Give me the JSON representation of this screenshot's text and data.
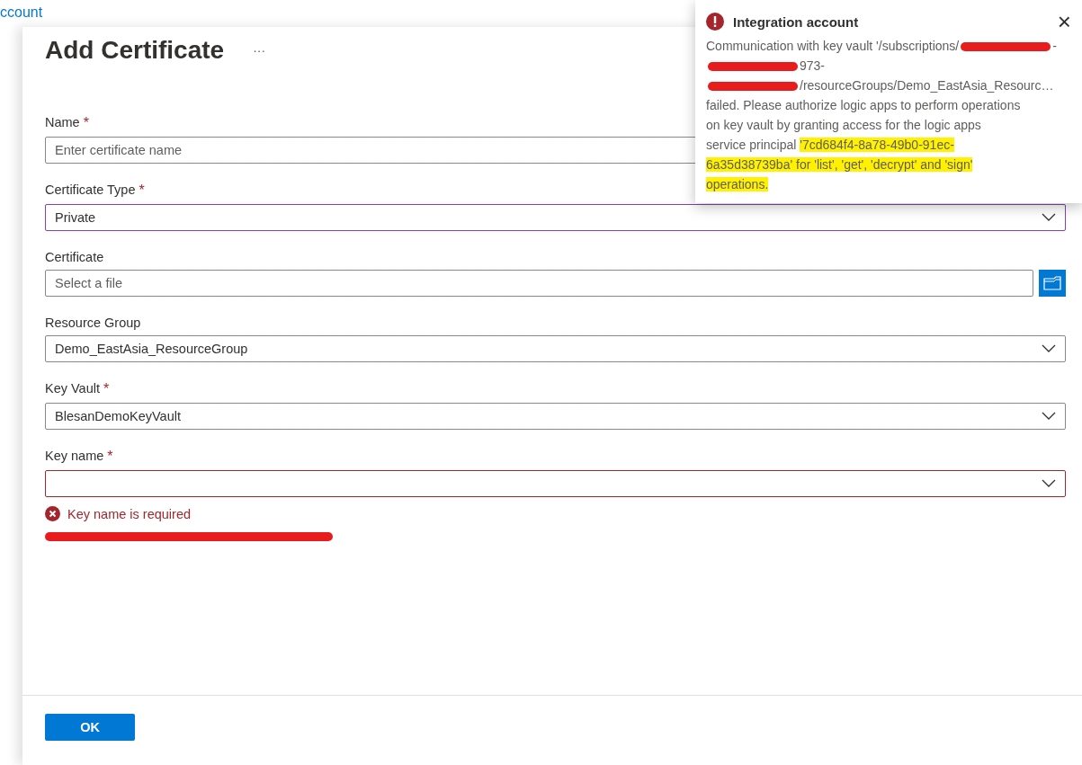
{
  "breadcrumb": {
    "link": "ccount"
  },
  "blade": {
    "title": "Add Certificate",
    "more": "···"
  },
  "fields": [
    {
      "kind": "text",
      "label": "Name",
      "required": true,
      "placeholder": "Enter certificate name",
      "focused": false
    },
    {
      "kind": "dropdown",
      "label": "Certificate Type",
      "required": true,
      "value": "Private",
      "focused": true
    },
    {
      "kind": "file",
      "label": "Certificate",
      "required": false,
      "placeholder": "Select a file",
      "focused": false
    },
    {
      "kind": "dropdown",
      "label": "Resource Group",
      "required": false,
      "value": "Demo_EastAsia_ResourceGroup",
      "focused": false
    },
    {
      "kind": "dropdown",
      "label": "Key Vault",
      "required": true,
      "value": "BlesanDemoKeyVault",
      "focused": false
    },
    {
      "kind": "dropdown",
      "label": "Key name",
      "required": true,
      "focused": false,
      "error": "Key name is required"
    }
  ],
  "required_marker": "*",
  "footer": {
    "ok_button": "OK"
  },
  "notification": {
    "title": "Integration account",
    "close": "×",
    "lines": [
      [
        {
          "kind": "text",
          "text": "Communication with key vault '/subscriptions/"
        },
        {
          "kind": "redacted"
        },
        {
          "kind": "text",
          "text": "-"
        }
      ],
      [
        {
          "kind": "redacted"
        },
        {
          "kind": "text",
          "text": "973-"
        }
      ],
      [
        {
          "kind": "redacted"
        },
        {
          "kind": "text",
          "text": "/resourceGroups/Demo_EastAsia_Resourc…"
        }
      ],
      [
        {
          "kind": "text",
          "text": "failed. Please authorize logic apps to perform operations"
        }
      ],
      [
        {
          "kind": "text",
          "text": "on key vault by granting access for the logic apps"
        }
      ],
      [
        {
          "kind": "text",
          "text": "service principal "
        },
        {
          "kind": "highlight",
          "text": "'7cd684f4-8a78-49b0-91ec-"
        }
      ],
      [
        {
          "kind": "highlight",
          "text": "6a35d38739ba' for 'list', 'get', 'decrypt' and 'sign'"
        }
      ],
      [
        {
          "kind": "highlight",
          "text": "operations."
        }
      ]
    ]
  }
}
